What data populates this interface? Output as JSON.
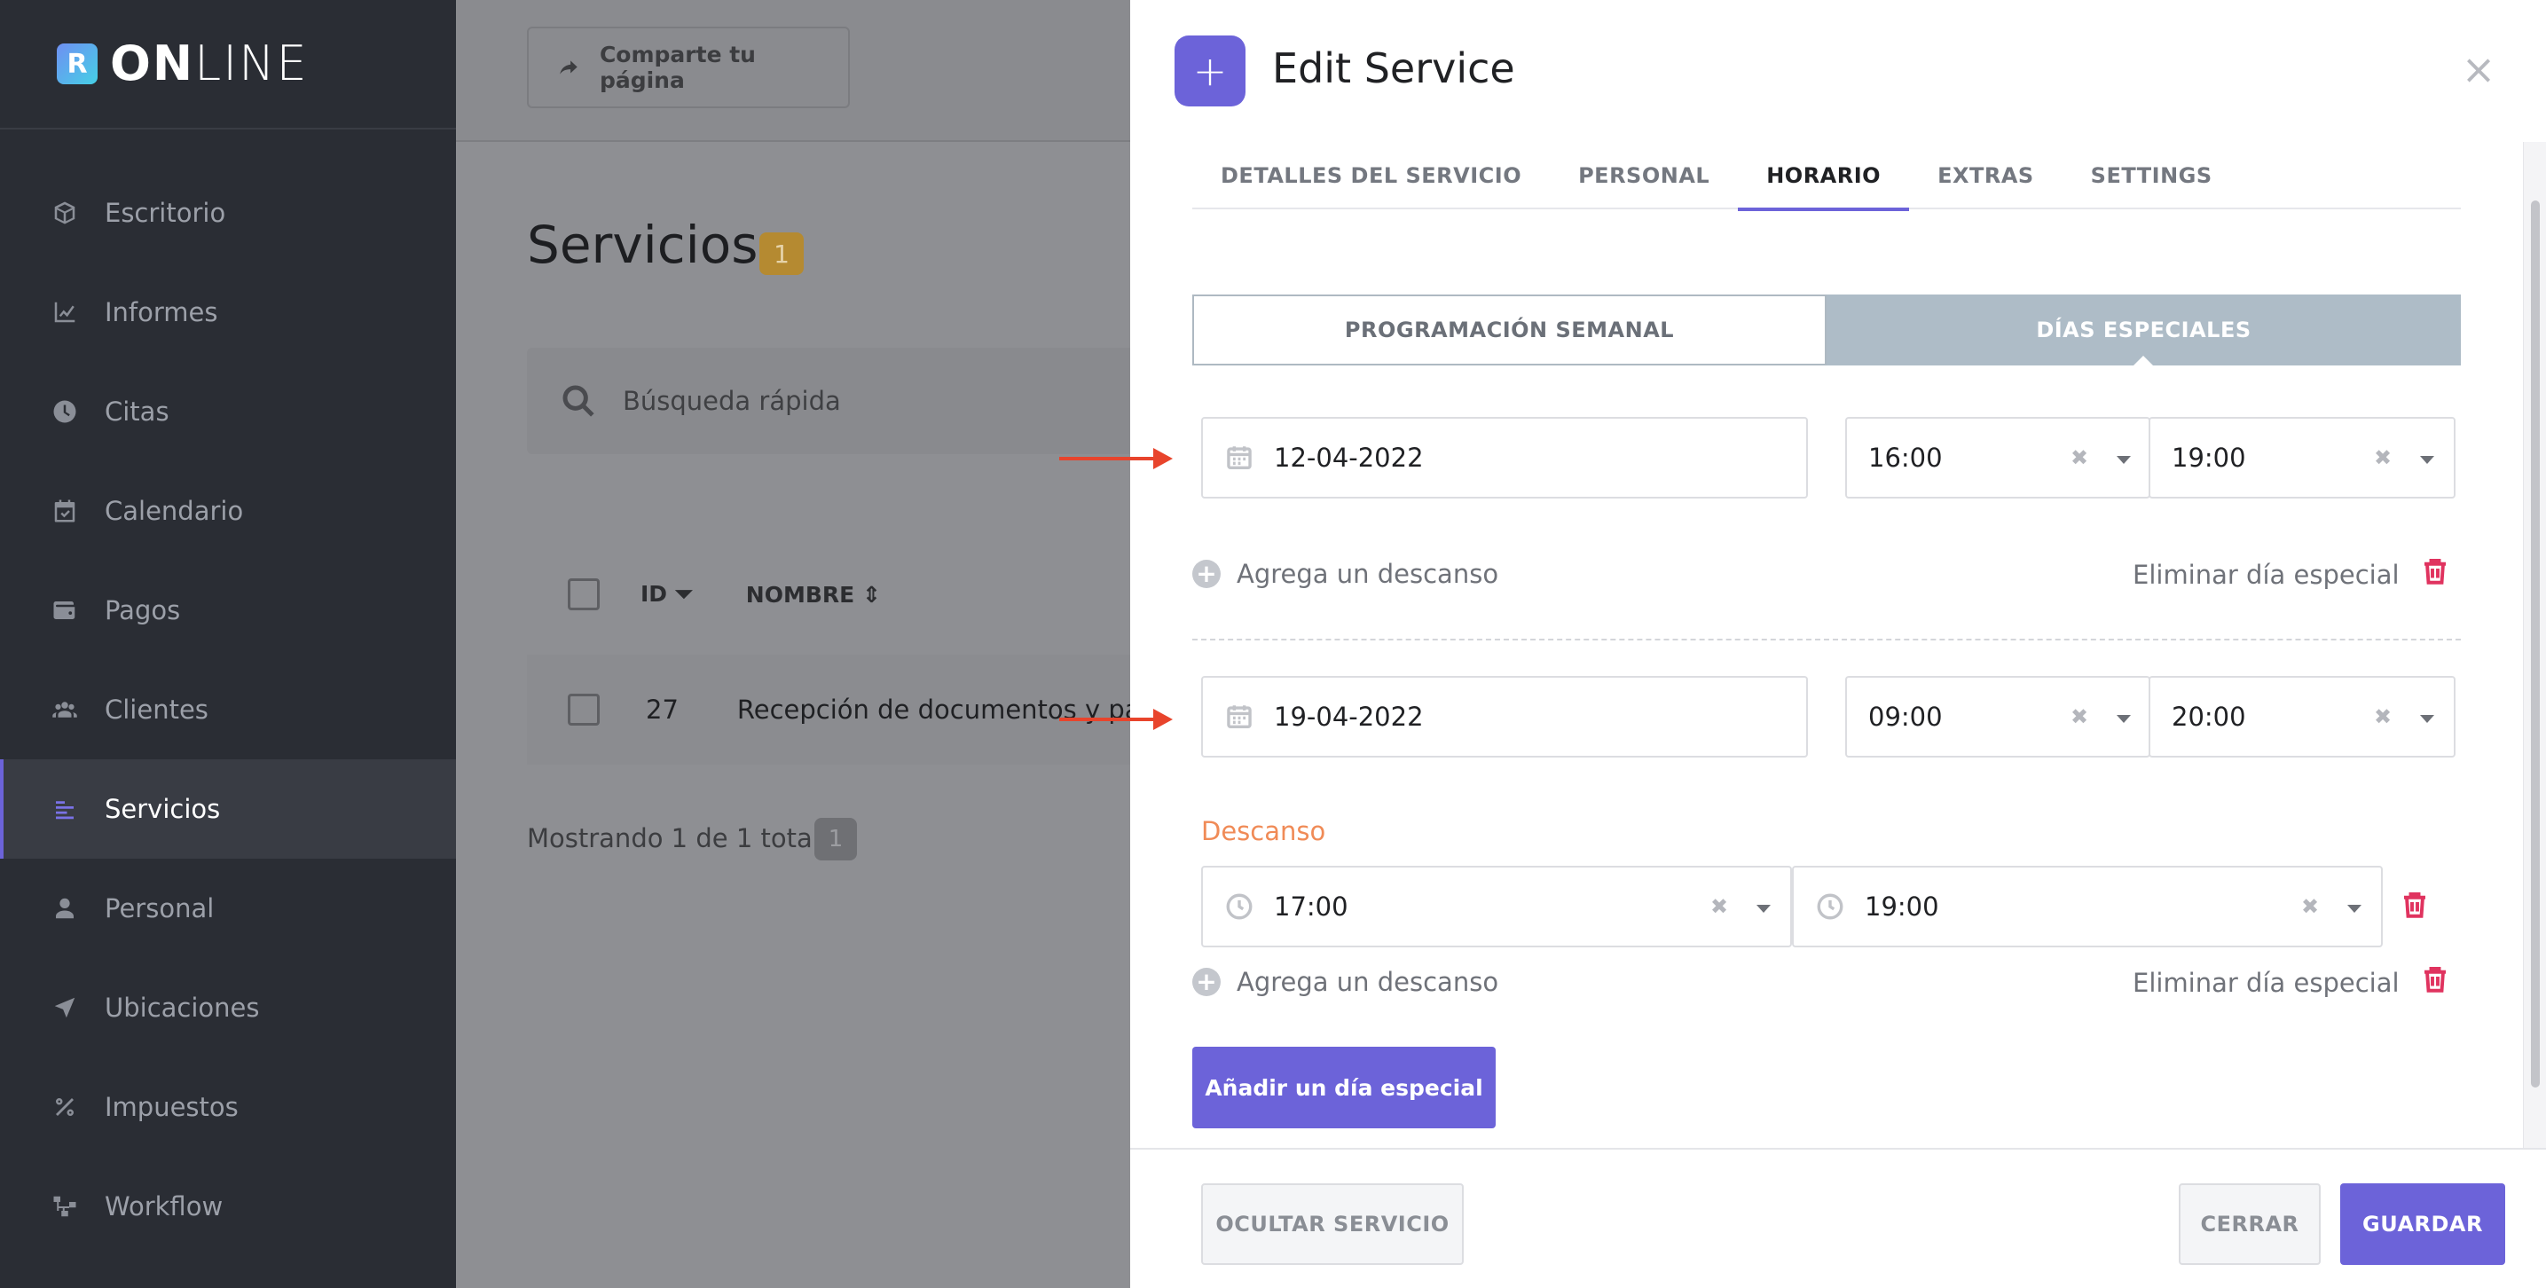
{
  "brand": {
    "mark": "R",
    "bold": "ON",
    "light": "LINE"
  },
  "sidebar": {
    "items": [
      {
        "label": "Escritorio",
        "icon": "box-icon"
      },
      {
        "label": "Informes",
        "icon": "chart-line-icon"
      },
      {
        "label": "Citas",
        "icon": "clock-icon"
      },
      {
        "label": "Calendario",
        "icon": "calendar-check-icon"
      },
      {
        "label": "Pagos",
        "icon": "wallet-icon"
      },
      {
        "label": "Clientes",
        "icon": "users-icon"
      },
      {
        "label": "Servicios",
        "icon": "list-icon",
        "active": true
      },
      {
        "label": "Personal",
        "icon": "user-icon"
      },
      {
        "label": "Ubicaciones",
        "icon": "location-arrow-icon"
      },
      {
        "label": "Impuestos",
        "icon": "percent-icon"
      },
      {
        "label": "Workflow",
        "icon": "workflow-icon"
      }
    ]
  },
  "page": {
    "share_label": "Comparte tu página",
    "title": "Servicios",
    "count": "1",
    "search_placeholder": "Búsqueda rápida",
    "columns": {
      "id": "ID",
      "name": "NOMBRE"
    },
    "rows": [
      {
        "id": "27",
        "name": "Recepción de documentos y pa"
      }
    ],
    "showing": "Mostrando 1 de 1 total",
    "showing_count": "1"
  },
  "drawer": {
    "title": "Edit Service",
    "tabs": [
      "DETALLES DEL SERVICIO",
      "PERSONAL",
      "HORARIO",
      "EXTRAS",
      "SETTINGS"
    ],
    "active_tab": "HORARIO",
    "segments": {
      "weekly": "PROGRAMACIÓN SEMANAL",
      "special": "DÍAS ESPECIALES"
    },
    "special_days": [
      {
        "date": "12-04-2022",
        "from": "16:00",
        "to": "19:00"
      },
      {
        "date": "19-04-2022",
        "from": "09:00",
        "to": "20:00"
      }
    ],
    "break": {
      "label": "Descanso",
      "from": "17:00",
      "to": "19:00"
    },
    "add_break_label": "Agrega un descanso",
    "remove_special_label": "Eliminar día especial",
    "add_special_label": "Añadir un día especial",
    "footer": {
      "hide": "OCULTAR SERVICIO",
      "close": "CERRAR",
      "save": "GUARDAR"
    }
  },
  "colors": {
    "accent": "#6c63d9",
    "danger": "#e0335f",
    "arrow": "#e8442c",
    "break_label": "#f08b57"
  }
}
